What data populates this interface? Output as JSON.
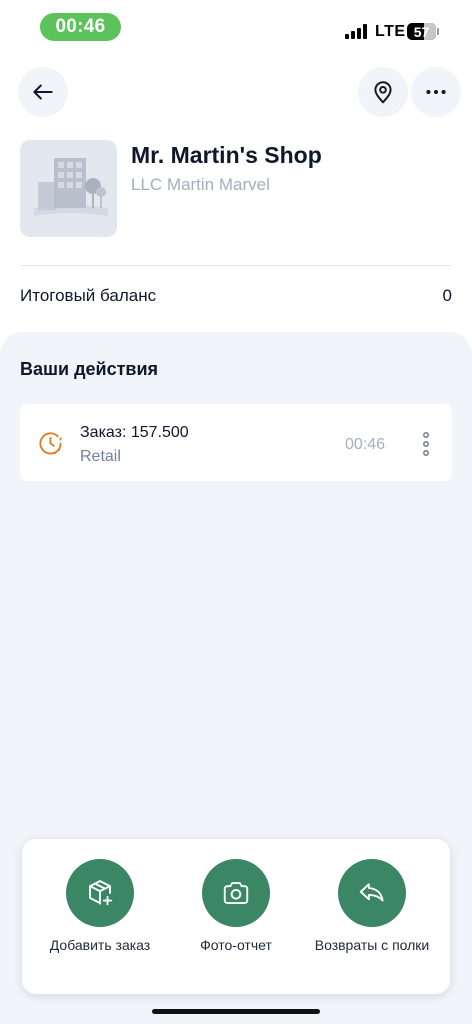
{
  "status_bar": {
    "time": "00:46",
    "network": "LTE",
    "battery_level": "57",
    "battery_fraction": 0.57
  },
  "header": {
    "back_icon": "arrow-left-icon",
    "location_icon": "map-pin-icon",
    "more_icon": "more-horizontal-icon"
  },
  "shop": {
    "name": "Mr. Martin's Shop",
    "company": "LLC Martin Marvel",
    "thumbnail_icon": "building-placeholder-icon"
  },
  "balance": {
    "label": "Итоговый баланс",
    "value": "0"
  },
  "actions": {
    "title": "Ваши действия",
    "items": [
      {
        "title": "Заказ: 157.500",
        "subtitle": "Retail",
        "time": "00:46",
        "icon": "clock-icon",
        "icon_color": "#d9822b"
      }
    ]
  },
  "bottom_panel": {
    "buttons": [
      {
        "label": "Добавить заказ",
        "icon": "box-plus-icon"
      },
      {
        "label": "Фото-отчет",
        "icon": "camera-icon"
      },
      {
        "label": "Возвраты с полки",
        "icon": "reply-arrow-icon"
      }
    ]
  },
  "colors": {
    "status_pill": "#5cc25a",
    "accent_green": "#3a8665",
    "background_gray": "#f1f4f9",
    "muted_text": "#a5afbd",
    "clock_orange": "#d9822b"
  }
}
